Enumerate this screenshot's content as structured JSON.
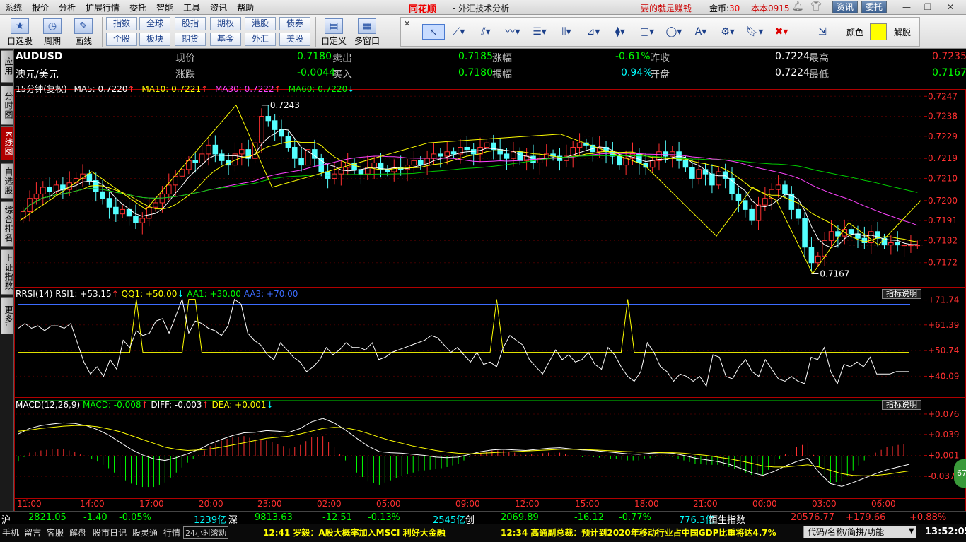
{
  "menu": {
    "items": [
      "系统",
      "报价",
      "分析",
      "扩展行情",
      "委托",
      "智能",
      "工具",
      "资讯",
      "帮助"
    ],
    "brand": "同花顺",
    "subtitle": "- 外汇技术分析",
    "slogan": "要的就是赚钱",
    "coins_label": "金币:",
    "coins_value": "30",
    "user": "本本0915",
    "news_btn": "资讯",
    "trade_btn": "委托"
  },
  "toolbar": {
    "big": [
      {
        "label": "自选股",
        "icon": "star-icon"
      },
      {
        "label": "周期",
        "icon": "clock-icon"
      },
      {
        "label": "画线",
        "icon": "pen-icon"
      }
    ],
    "grid": [
      [
        "指数",
        "全球",
        "股指",
        "期权",
        "港股",
        "债券"
      ],
      [
        "个股",
        "板块",
        "期货",
        "基金",
        "外汇",
        "美股"
      ]
    ],
    "right": [
      {
        "label": "自定义",
        "icon": "window-icon"
      },
      {
        "label": "多窗口",
        "icon": "grid-icon"
      }
    ],
    "tools_color_label": "颜色",
    "tools_unlock_label": "解脱"
  },
  "sidenav": [
    "应用",
    "分时图",
    "K线图",
    "自选股",
    "综合排名",
    "上证指数",
    "更多."
  ],
  "quote": {
    "symbol": "AUDUSD",
    "name": "澳元/美元",
    "rows": [
      [
        {
          "l": "现价",
          "v": "0.7180"
        },
        {
          "l": "卖出",
          "v": "0.7185"
        },
        {
          "l": "涨幅",
          "v": "-0.61%"
        },
        {
          "l": "昨收",
          "v": "0.7224"
        },
        {
          "l": "最高",
          "v": "0.7235"
        }
      ],
      [
        {
          "l": "涨跌",
          "v": "-0.0044"
        },
        {
          "l": "买入",
          "v": "0.7180"
        },
        {
          "l": "振幅",
          "v": "0.94%"
        },
        {
          "l": "开盘",
          "v": "0.7224"
        },
        {
          "l": "最低",
          "v": "0.7167"
        }
      ]
    ]
  },
  "legend": {
    "period": "15分钟(复权)",
    "ma5": "MA5: 0.7220",
    "ma10": "MA10: 0.7221",
    "ma30": "MA30: 0.7222",
    "ma60": "MA60: 0.7220"
  },
  "rsi_legend": {
    "name": "RRSI(14)",
    "rsi1": "RSI1: +53.15",
    "qq1": "QQ1: +50.00",
    "aa1": "AA1: +30.00",
    "aa3": "AA3: +70.00",
    "btn": "指标说明"
  },
  "macd_legend": {
    "name": "MACD(12,26,9)",
    "macd": "MACD: -0.008",
    "diff": "DIFF: -0.003",
    "dea": "DEA: +0.001",
    "btn": "指标说明"
  },
  "chart_data": [
    {
      "type": "candlestick",
      "title": "AUDUSD 15分钟",
      "y_ticks": [
        "0.7247",
        "0.7238",
        "0.7229",
        "0.7219",
        "0.7210",
        "0.7200",
        "0.7191",
        "0.7182",
        "0.7172"
      ],
      "ylim": [
        0.7163,
        0.7249
      ],
      "x_ticks": [
        "11:00",
        "14:00",
        "17:00",
        "20:00",
        "23:00",
        "02:00",
        "05:00",
        "09:00",
        "12:00",
        "15:00",
        "18:00",
        "21:00",
        "00:00",
        "03:00",
        "06:00"
      ],
      "close": [
        0.7195,
        0.7201,
        0.7203,
        0.7206,
        0.7204,
        0.7207,
        0.7205,
        0.7208,
        0.721,
        0.7212,
        0.7209,
        0.7204,
        0.7201,
        0.7197,
        0.7194,
        0.7196,
        0.7193,
        0.719,
        0.7192,
        0.7197,
        0.7199,
        0.7203,
        0.7207,
        0.7211,
        0.7214,
        0.7218,
        0.7217,
        0.7221,
        0.7225,
        0.7221,
        0.7218,
        0.7216,
        0.7221,
        0.7223,
        0.7219,
        0.7226,
        0.7238,
        0.7236,
        0.7232,
        0.7229,
        0.7224,
        0.7219,
        0.7216,
        0.7223,
        0.7219,
        0.7213,
        0.721,
        0.7212,
        0.7215,
        0.7217,
        0.7214,
        0.7212,
        0.7215,
        0.7217,
        0.7214,
        0.7213,
        0.7215,
        0.7214,
        0.7216,
        0.7218,
        0.7216,
        0.7219,
        0.7221,
        0.722,
        0.7222,
        0.7221,
        0.7224,
        0.7223,
        0.7221,
        0.7224,
        0.7226,
        0.7223,
        0.7221,
        0.7219,
        0.7222,
        0.7218,
        0.722,
        0.7217,
        0.7219,
        0.7221,
        0.722,
        0.7218,
        0.722,
        0.7224,
        0.7226,
        0.7225,
        0.7222,
        0.7224,
        0.7222,
        0.722,
        0.7216,
        0.7219,
        0.7221,
        0.7217,
        0.7215,
        0.7218,
        0.7222,
        0.722,
        0.7222,
        0.7218,
        0.7215,
        0.721,
        0.7214,
        0.7212,
        0.7207,
        0.7213,
        0.721,
        0.7203,
        0.72,
        0.7196,
        0.7191,
        0.7198,
        0.7201,
        0.7205,
        0.7207,
        0.7203,
        0.7196,
        0.7192,
        0.7179,
        0.7172,
        0.7175,
        0.7182,
        0.7186,
        0.7184,
        0.7187,
        0.7185,
        0.7183,
        0.7181,
        0.7186,
        0.7183,
        0.718,
        0.7181,
        0.718,
        0.718,
        0.718,
        0.718
      ]
    },
    {
      "type": "line",
      "title": "RRSI(14)",
      "y_ticks": [
        "+71.74",
        "+61.39",
        "+50.74",
        "+40.09"
      ],
      "ylim": [
        32,
        76
      ],
      "series": [
        {
          "name": "RSI1",
          "values": [
            60,
            62,
            60,
            61,
            59,
            61,
            61,
            60,
            62,
            54,
            46,
            41,
            44,
            40,
            47,
            43,
            55,
            52,
            59,
            57,
            58,
            63,
            64,
            58,
            65,
            72,
            58,
            63,
            62,
            60,
            59,
            57,
            61,
            72,
            70,
            58,
            55,
            53,
            49,
            47,
            54,
            51,
            48,
            46,
            42,
            44,
            47,
            52,
            49,
            51,
            54,
            52,
            52,
            51,
            54,
            47,
            48,
            50,
            51,
            52,
            53,
            54,
            55,
            57,
            56,
            53,
            50,
            52,
            49,
            46,
            50,
            45,
            46,
            44,
            52,
            57,
            55,
            53,
            47,
            44,
            41,
            46,
            51,
            47,
            49,
            46,
            47,
            50,
            45,
            43,
            52,
            49,
            44,
            40,
            38,
            42,
            54,
            50,
            44,
            42,
            38,
            41,
            40,
            38,
            40,
            36,
            49,
            48,
            40,
            39,
            44,
            47,
            42,
            40,
            47,
            43,
            39,
            38,
            40,
            38,
            37,
            48,
            47,
            52,
            42,
            37,
            45,
            44,
            46,
            44,
            48,
            41,
            41,
            41,
            42,
            42,
            42
          ]
        }
      ]
    },
    {
      "type": "line",
      "title": "MACD(12,26,9)",
      "y_ticks": [
        "+0.076",
        "+0.039",
        "+0.001",
        "-0.037"
      ],
      "ylim": [
        -0.07,
        0.09
      ],
      "series": [
        {
          "name": "DIFF",
          "values": [
            0.04,
            0.05,
            0.055,
            0.058,
            0.06,
            0.059,
            0.055,
            0.048,
            0.038,
            0.025,
            0.012,
            0.002,
            -0.005,
            -0.008,
            -0.003,
            0.004,
            0.012,
            0.022,
            0.03,
            0.037,
            0.042,
            0.043,
            0.046,
            0.045,
            0.043,
            0.05,
            0.062,
            0.068,
            0.06,
            0.047,
            0.032,
            0.018,
            0.008,
            0.006,
            0.005,
            0.003,
            0.001,
            -0.002,
            -0.003,
            -0.002,
            0.003,
            0.008,
            0.011,
            0.012,
            0.011,
            0.01,
            0.012,
            0.014,
            0.015,
            0.013,
            0.011,
            0.01,
            0.008,
            0.006,
            0.004,
            0.003,
            0.005,
            0.006,
            0.005,
            0.001,
            -0.004,
            -0.007,
            -0.01,
            -0.015,
            -0.022,
            -0.03,
            -0.035,
            -0.028,
            -0.018,
            -0.01,
            -0.004,
            -0.03,
            -0.05,
            -0.055,
            -0.048,
            -0.04,
            -0.032,
            -0.025,
            -0.02,
            -0.015
          ]
        },
        {
          "name": "DEA",
          "values": [
            0.045,
            0.047,
            0.05,
            0.052,
            0.054,
            0.055,
            0.055,
            0.053,
            0.049,
            0.044,
            0.037,
            0.03,
            0.023,
            0.016,
            0.012,
            0.01,
            0.011,
            0.013,
            0.016,
            0.02,
            0.024,
            0.028,
            0.032,
            0.034,
            0.036,
            0.04,
            0.045,
            0.05,
            0.052,
            0.051,
            0.047,
            0.041,
            0.034,
            0.028,
            0.023,
            0.018,
            0.014,
            0.01,
            0.007,
            0.005,
            0.004,
            0.005,
            0.006,
            0.007,
            0.008,
            0.009,
            0.01,
            0.011,
            0.012,
            0.012,
            0.012,
            0.011,
            0.01,
            0.009,
            0.008,
            0.007,
            0.007,
            0.006,
            0.006,
            0.005,
            0.003,
            0.001,
            -0.002,
            -0.005,
            -0.009,
            -0.013,
            -0.018,
            -0.02,
            -0.02,
            -0.018,
            -0.016,
            -0.02,
            -0.026,
            -0.032,
            -0.035,
            -0.036,
            -0.035,
            -0.033,
            -0.03,
            -0.027
          ]
        }
      ]
    }
  ],
  "chart_labels": {
    "high_label": "0.7243",
    "low_label": "0.7167",
    "bubble": "67"
  },
  "ticker": [
    {
      "v": "沪",
      "c": "white"
    },
    {
      "v": "2821.05",
      "c": "green"
    },
    {
      "v": "-1.40",
      "c": "green"
    },
    {
      "v": "-0.05%",
      "c": "green"
    },
    {
      "v": "1239亿",
      "c": "cyan"
    },
    {
      "v": "深",
      "c": "white"
    },
    {
      "v": "9813.63",
      "c": "green"
    },
    {
      "v": "-12.51",
      "c": "green"
    },
    {
      "v": "-0.13%",
      "c": "green"
    },
    {
      "v": "2545亿",
      "c": "cyan"
    },
    {
      "v": "创",
      "c": "white"
    },
    {
      "v": "2069.89",
      "c": "green"
    },
    {
      "v": "-16.12",
      "c": "green"
    },
    {
      "v": "-0.77%",
      "c": "green"
    },
    {
      "v": "776.3亿",
      "c": "cyan"
    },
    {
      "v": "恒生指数",
      "c": "white"
    },
    {
      "v": "20576.77",
      "c": "red"
    },
    {
      "v": "+179.66",
      "c": "red"
    },
    {
      "v": "+0.88%",
      "c": "red"
    }
  ],
  "status": {
    "items": [
      "手机",
      "留言",
      "客服",
      "解盘",
      "股市日记",
      "股灵通",
      "行情",
      "24小时滚动"
    ],
    "news1": "12:41 罗毅：A股大概率加入MSCI 利好大金融",
    "news2": "12:34 高通副总裁：预计到2020年移动行业占中国GDP比重将达4.7%",
    "search": "代码/名称/简拼/功能",
    "clock": "13:52:05"
  }
}
